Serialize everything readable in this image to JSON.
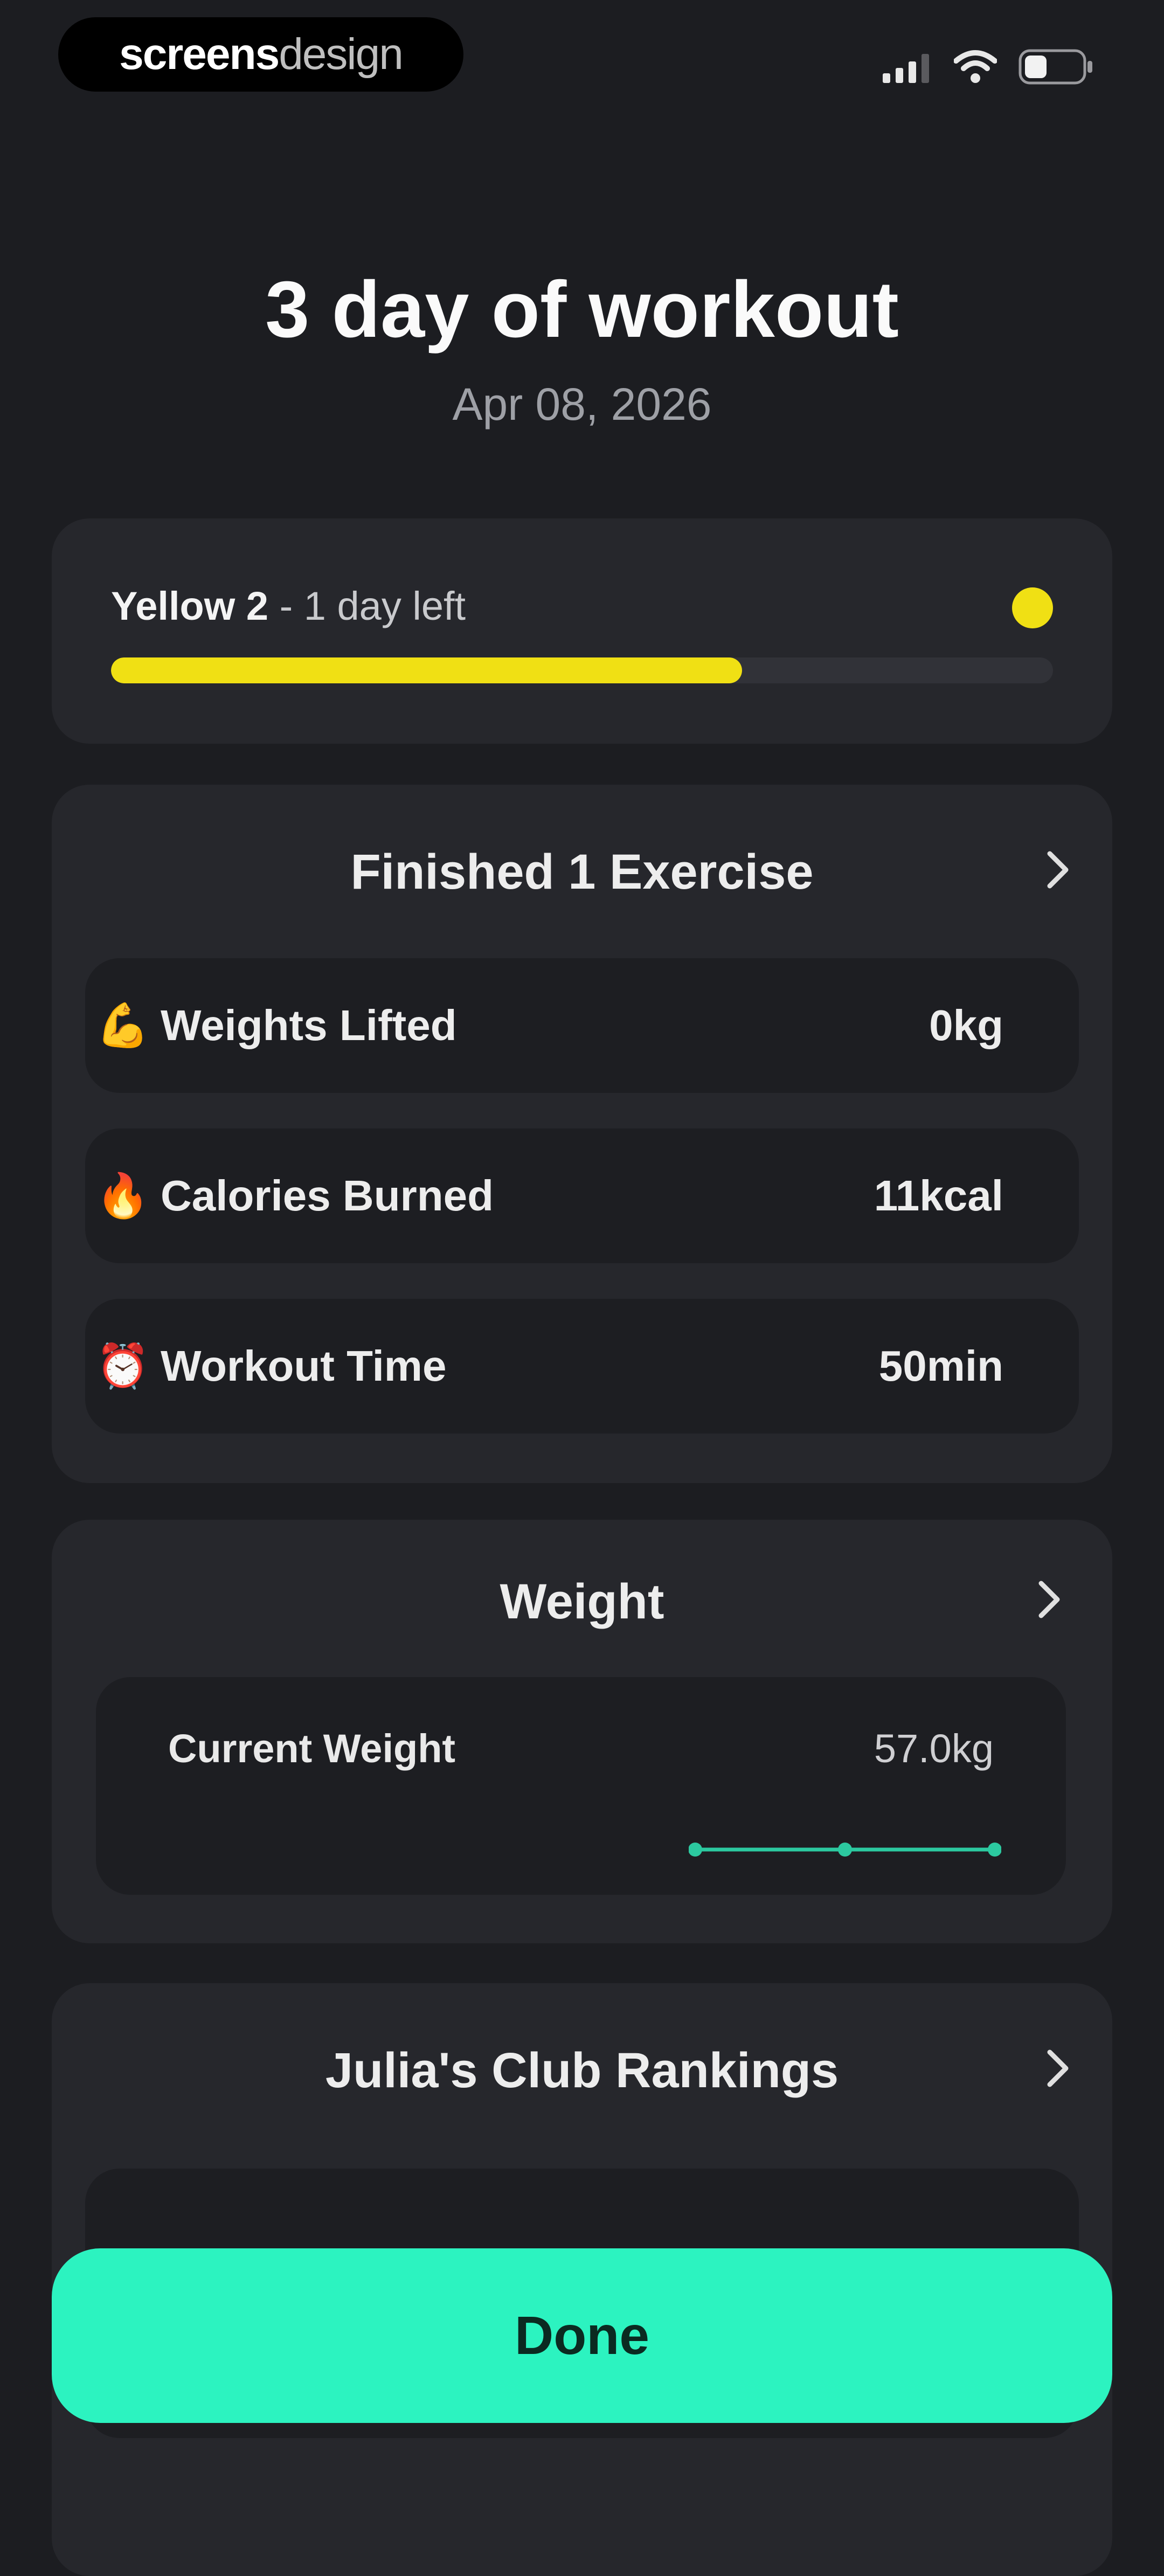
{
  "status_bar": {
    "brand_part1": "screens",
    "brand_part2": "design",
    "icons": [
      "signal-icon",
      "wifi-icon",
      "battery-icon"
    ]
  },
  "header": {
    "title": "3 day of workout",
    "date": "Apr 08, 2026"
  },
  "level": {
    "name": "Yellow 2",
    "separator": " - ",
    "remaining": "1 day left",
    "progress": 0.67,
    "color": "#f0e014"
  },
  "exercise": {
    "title": "Finished 1 Exercise",
    "rows": [
      {
        "icon": "💪",
        "label": "Weights Lifted",
        "value": "0kg"
      },
      {
        "icon": "🔥",
        "label": "Calories Burned",
        "value": "11kcal"
      },
      {
        "icon": "⏰",
        "label": "Workout Time",
        "value": "50min"
      }
    ]
  },
  "weight": {
    "title": "Weight",
    "current_label": "Current Weight",
    "current_value": "57.0kg",
    "trend_color": "#2cc9a0"
  },
  "rankings": {
    "title": "Julia's Club Rankings"
  },
  "done_button": {
    "label": "Done",
    "color": "#2cf3c0"
  }
}
